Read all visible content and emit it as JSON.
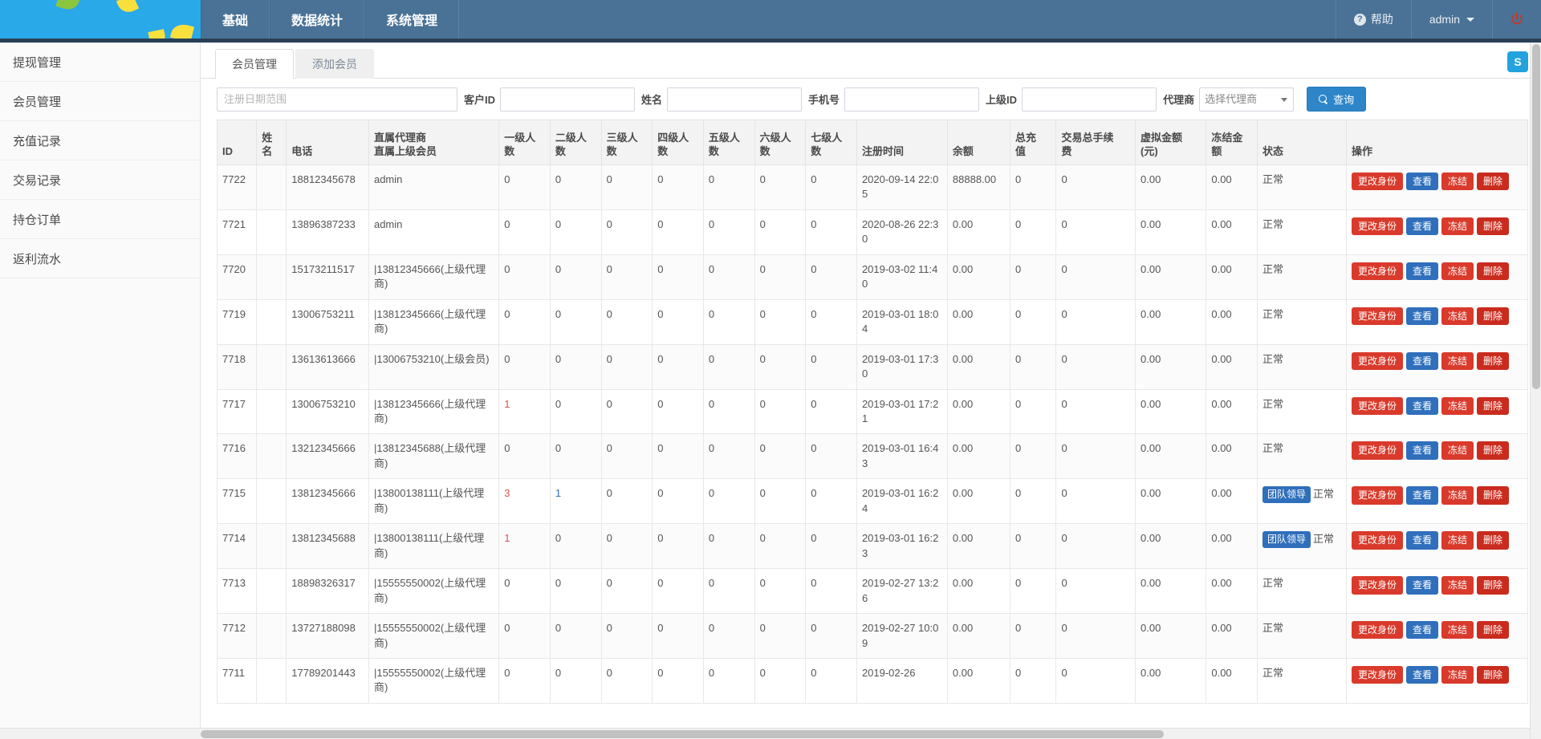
{
  "header": {
    "nav_left": [
      {
        "label": "基础"
      },
      {
        "label": "数据统计"
      },
      {
        "label": "系统管理"
      }
    ],
    "help_label": "帮助",
    "help_icon": "question-circle-icon",
    "user_label": "admin",
    "logout_icon": "power-icon",
    "brand_color": "#29a9e8",
    "navbar_color": "#4a7296"
  },
  "sidebar": {
    "items": [
      {
        "label": "提现管理"
      },
      {
        "label": "会员管理"
      },
      {
        "label": "充值记录"
      },
      {
        "label": "交易记录"
      },
      {
        "label": "持仓订单"
      },
      {
        "label": "返利流水"
      }
    ]
  },
  "tabs": [
    {
      "label": "会员管理",
      "active": true
    },
    {
      "label": "添加会员",
      "active": false
    }
  ],
  "filters": {
    "date_range": {
      "placeholder": "注册日期范围",
      "value": ""
    },
    "customer_id": {
      "label": "客户ID",
      "value": ""
    },
    "name": {
      "label": "姓名",
      "value": ""
    },
    "phone": {
      "label": "手机号",
      "value": ""
    },
    "parent_id": {
      "label": "上级ID",
      "value": ""
    },
    "agent": {
      "label": "代理商",
      "selected": "选择代理商",
      "options": [
        "选择代理商"
      ]
    },
    "query_button": {
      "label": "查询",
      "icon": "search-icon",
      "color": "#2e86c9"
    }
  },
  "table": {
    "columns": [
      {
        "key": "id",
        "label": "ID"
      },
      {
        "key": "name",
        "label": "姓\n名"
      },
      {
        "key": "phone",
        "label": "电话"
      },
      {
        "key": "agent",
        "label": "直属代理商\n直属上级会员"
      },
      {
        "key": "lv1",
        "label": "一级人\n数"
      },
      {
        "key": "lv2",
        "label": "二级人\n数"
      },
      {
        "key": "lv3",
        "label": "三级人\n数"
      },
      {
        "key": "lv4",
        "label": "四级人\n数"
      },
      {
        "key": "lv5",
        "label": "五级人\n数"
      },
      {
        "key": "lv6",
        "label": "六级人\n数"
      },
      {
        "key": "lv7",
        "label": "七级人\n数"
      },
      {
        "key": "reg_time",
        "label": "注册时间"
      },
      {
        "key": "balance",
        "label": "余额"
      },
      {
        "key": "total_recharge",
        "label": "总充\n值"
      },
      {
        "key": "total_fee",
        "label": "交易总手续\n费"
      },
      {
        "key": "virtual_amount",
        "label": "虚拟金额\n(元)"
      },
      {
        "key": "frozen",
        "label": "冻结金\n额"
      },
      {
        "key": "status",
        "label": "状态"
      },
      {
        "key": "ops",
        "label": "操作"
      }
    ],
    "action_labels": {
      "change_identity": "更改身份",
      "view": "查看",
      "freeze": "冻结",
      "delete": "删除"
    },
    "badge_leader": "团队领导",
    "rows": [
      {
        "id": "7722",
        "name": "",
        "phone": "18812345678",
        "agent": "admin",
        "lv1": "0",
        "lv2": "0",
        "lv3": "0",
        "lv4": "0",
        "lv5": "0",
        "lv6": "0",
        "lv7": "0",
        "reg_time": "2020-09-14 22:05",
        "balance": "88888.00",
        "total_recharge": "0",
        "total_fee": "0",
        "virtual_amount": "0.00",
        "frozen": "0.00",
        "status": "正常",
        "leader": false
      },
      {
        "id": "7721",
        "name": "",
        "phone": "13896387233",
        "agent": "admin",
        "lv1": "0",
        "lv2": "0",
        "lv3": "0",
        "lv4": "0",
        "lv5": "0",
        "lv6": "0",
        "lv7": "0",
        "reg_time": "2020-08-26 22:30",
        "balance": "0.00",
        "total_recharge": "0",
        "total_fee": "0",
        "virtual_amount": "0.00",
        "frozen": "0.00",
        "status": "正常",
        "leader": false
      },
      {
        "id": "7720",
        "name": "",
        "phone": "15173211517",
        "agent": "|13812345666(上级代理商)",
        "lv1": "0",
        "lv2": "0",
        "lv3": "0",
        "lv4": "0",
        "lv5": "0",
        "lv6": "0",
        "lv7": "0",
        "reg_time": "2019-03-02 11:40",
        "balance": "0.00",
        "total_recharge": "0",
        "total_fee": "0",
        "virtual_amount": "0.00",
        "frozen": "0.00",
        "status": "正常",
        "leader": false
      },
      {
        "id": "7719",
        "name": "",
        "phone": "13006753211",
        "agent": "|13812345666(上级代理商)",
        "lv1": "0",
        "lv2": "0",
        "lv3": "0",
        "lv4": "0",
        "lv5": "0",
        "lv6": "0",
        "lv7": "0",
        "reg_time": "2019-03-01 18:04",
        "balance": "0.00",
        "total_recharge": "0",
        "total_fee": "0",
        "virtual_amount": "0.00",
        "frozen": "0.00",
        "status": "正常",
        "leader": false
      },
      {
        "id": "7718",
        "name": "",
        "phone": "13613613666",
        "agent": "|13006753210(上级会员)",
        "lv1": "0",
        "lv2": "0",
        "lv3": "0",
        "lv4": "0",
        "lv5": "0",
        "lv6": "0",
        "lv7": "0",
        "reg_time": "2019-03-01 17:30",
        "balance": "0.00",
        "total_recharge": "0",
        "total_fee": "0",
        "virtual_amount": "0.00",
        "frozen": "0.00",
        "status": "正常",
        "leader": false
      },
      {
        "id": "7717",
        "name": "",
        "phone": "13006753210",
        "agent": "|13812345666(上级代理商)",
        "lv1": "1",
        "lv1_color": "red",
        "lv2": "0",
        "lv3": "0",
        "lv4": "0",
        "lv5": "0",
        "lv6": "0",
        "lv7": "0",
        "reg_time": "2019-03-01 17:21",
        "balance": "0.00",
        "total_recharge": "0",
        "total_fee": "0",
        "virtual_amount": "0.00",
        "frozen": "0.00",
        "status": "正常",
        "leader": false
      },
      {
        "id": "7716",
        "name": "",
        "phone": "13212345666",
        "agent": "|13812345688(上级代理商)",
        "lv1": "0",
        "lv2": "0",
        "lv3": "0",
        "lv4": "0",
        "lv5": "0",
        "lv6": "0",
        "lv7": "0",
        "reg_time": "2019-03-01 16:43",
        "balance": "0.00",
        "total_recharge": "0",
        "total_fee": "0",
        "virtual_amount": "0.00",
        "frozen": "0.00",
        "status": "正常",
        "leader": false
      },
      {
        "id": "7715",
        "name": "",
        "phone": "13812345666",
        "agent": "|13800138111(上级代理商)",
        "lv1": "3",
        "lv1_color": "red",
        "lv2": "1",
        "lv2_color": "blue",
        "lv3": "0",
        "lv4": "0",
        "lv5": "0",
        "lv6": "0",
        "lv7": "0",
        "reg_time": "2019-03-01 16:24",
        "balance": "0.00",
        "total_recharge": "0",
        "total_fee": "0",
        "virtual_amount": "0.00",
        "frozen": "0.00",
        "status": "正常",
        "leader": true
      },
      {
        "id": "7714",
        "name": "",
        "phone": "13812345688",
        "agent": "|13800138111(上级代理商)",
        "lv1": "1",
        "lv1_color": "red",
        "lv2": "0",
        "lv3": "0",
        "lv4": "0",
        "lv5": "0",
        "lv6": "0",
        "lv7": "0",
        "reg_time": "2019-03-01 16:23",
        "balance": "0.00",
        "total_recharge": "0",
        "total_fee": "0",
        "virtual_amount": "0.00",
        "frozen": "0.00",
        "status": "正常",
        "leader": true
      },
      {
        "id": "7713",
        "name": "",
        "phone": "18898326317",
        "agent": "|15555550002(上级代理商)",
        "lv1": "0",
        "lv2": "0",
        "lv3": "0",
        "lv4": "0",
        "lv5": "0",
        "lv6": "0",
        "lv7": "0",
        "reg_time": "2019-02-27 13:26",
        "balance": "0.00",
        "total_recharge": "0",
        "total_fee": "0",
        "virtual_amount": "0.00",
        "frozen": "0.00",
        "status": "正常",
        "leader": false
      },
      {
        "id": "7712",
        "name": "",
        "phone": "13727188098",
        "agent": "|15555550002(上级代理商)",
        "lv1": "0",
        "lv2": "0",
        "lv3": "0",
        "lv4": "0",
        "lv5": "0",
        "lv6": "0",
        "lv7": "0",
        "reg_time": "2019-02-27 10:09",
        "balance": "0.00",
        "total_recharge": "0",
        "total_fee": "0",
        "virtual_amount": "0.00",
        "frozen": "0.00",
        "status": "正常",
        "leader": false
      },
      {
        "id": "7711",
        "name": "",
        "phone": "17789201443",
        "agent": "|15555550002(上级代理商)",
        "lv1": "0",
        "lv2": "0",
        "lv3": "0",
        "lv4": "0",
        "lv5": "0",
        "lv6": "0",
        "lv7": "0",
        "reg_time": "2019-02-26",
        "balance": "0.00",
        "total_recharge": "0",
        "total_fee": "0",
        "virtual_amount": "0.00",
        "frozen": "0.00",
        "status": "正常",
        "leader": false
      }
    ]
  },
  "widget": {
    "label": "S"
  }
}
